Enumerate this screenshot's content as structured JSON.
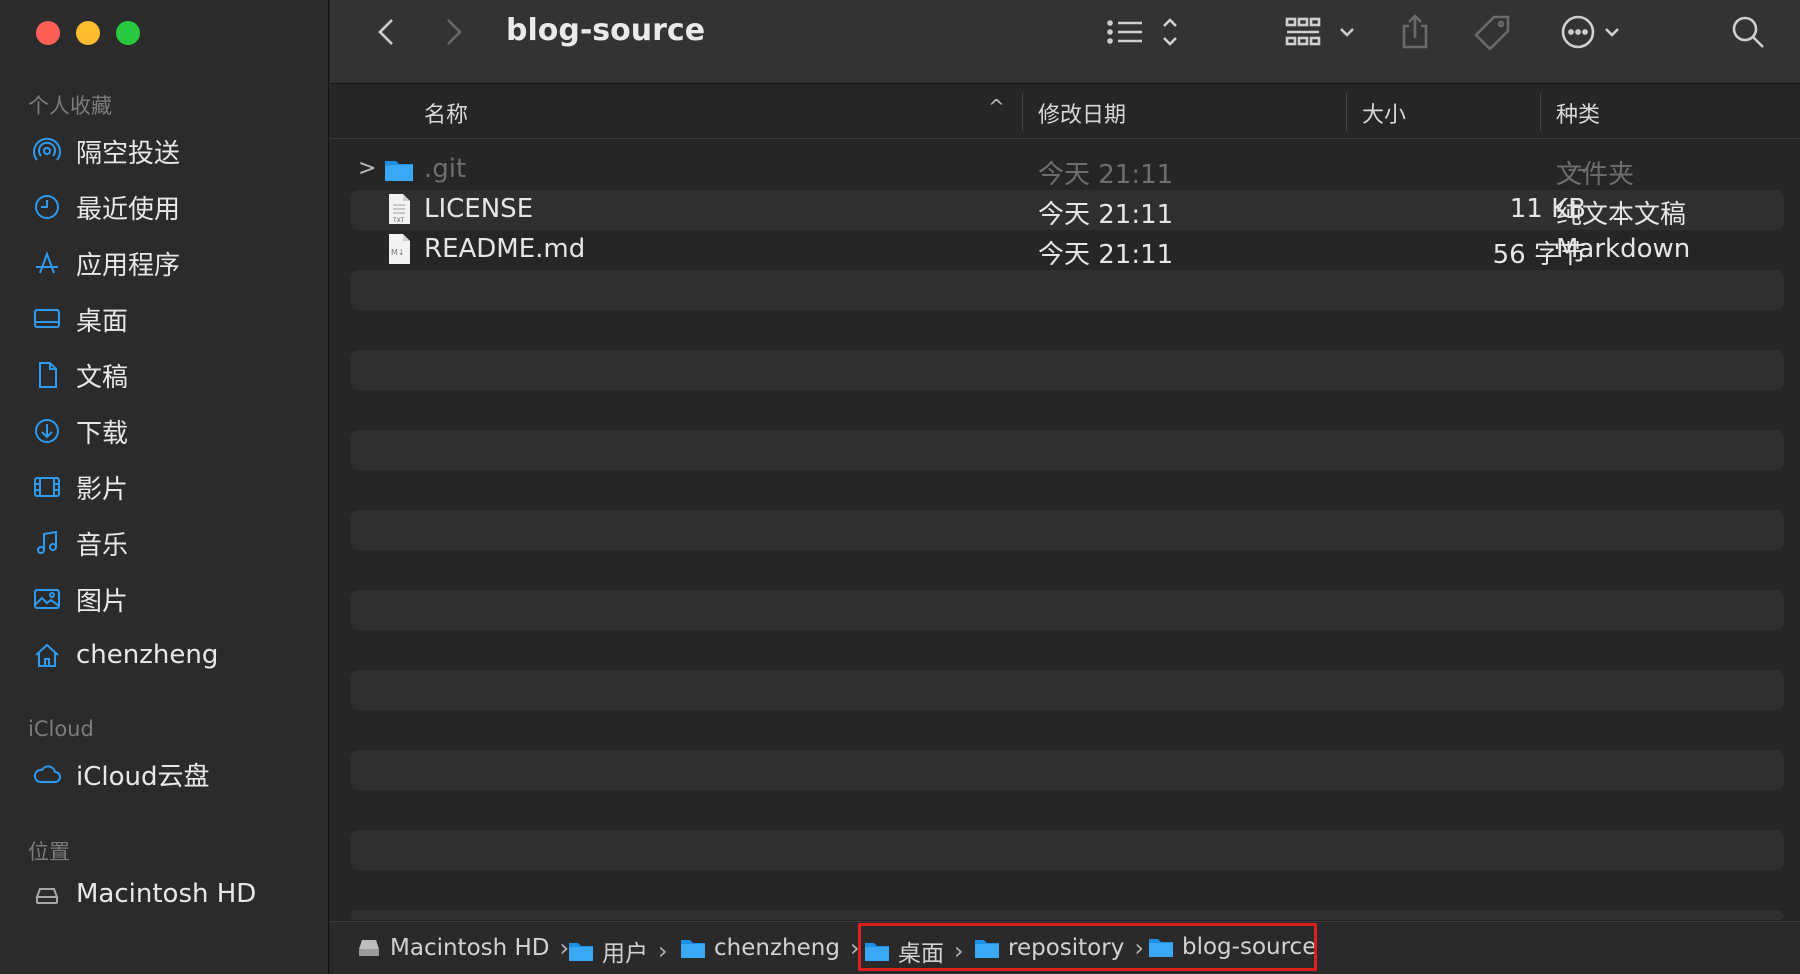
{
  "window": {
    "title": "blog-source"
  },
  "sidebar": {
    "sections": {
      "favorites": "个人收藏",
      "icloud": "iCloud",
      "locations": "位置"
    },
    "items": [
      {
        "label": "隔空投送",
        "icon": "airdrop-icon"
      },
      {
        "label": "最近使用",
        "icon": "clock-icon"
      },
      {
        "label": "应用程序",
        "icon": "applications-icon"
      },
      {
        "label": "桌面",
        "icon": "desktop-icon"
      },
      {
        "label": "文稿",
        "icon": "document-icon"
      },
      {
        "label": "下载",
        "icon": "download-icon"
      },
      {
        "label": "影片",
        "icon": "film-icon"
      },
      {
        "label": "音乐",
        "icon": "music-icon"
      },
      {
        "label": "图片",
        "icon": "photo-icon"
      },
      {
        "label": "chenzheng",
        "icon": "home-icon"
      },
      {
        "label": "iCloud云盘",
        "icon": "cloud-icon"
      },
      {
        "label": "Macintosh HD",
        "icon": "disk-icon"
      }
    ]
  },
  "columns": {
    "name": "名称",
    "date": "修改日期",
    "size": "大小",
    "kind": "种类"
  },
  "files": [
    {
      "name": ".git",
      "date": "今天 21:11",
      "size": "--",
      "kind": "文件夹",
      "dimmed": true,
      "icon": "folder-icon"
    },
    {
      "name": "LICENSE",
      "date": "今天 21:11",
      "size": "11 KB",
      "kind": "纯文本文稿",
      "dimmed": false,
      "icon": "text-file-icon"
    },
    {
      "name": "README.md",
      "date": "今天 21:11",
      "size": "56 字节",
      "kind": "Markdown",
      "dimmed": false,
      "icon": "markdown-file-icon"
    }
  ],
  "pathbar": {
    "crumbs": [
      "Macintosh HD",
      "用户",
      "chenzheng",
      "桌面",
      "repository",
      "blog-source"
    ]
  },
  "colors": {
    "accent": "#2e9bf0",
    "highlight": "#e01e1e"
  }
}
